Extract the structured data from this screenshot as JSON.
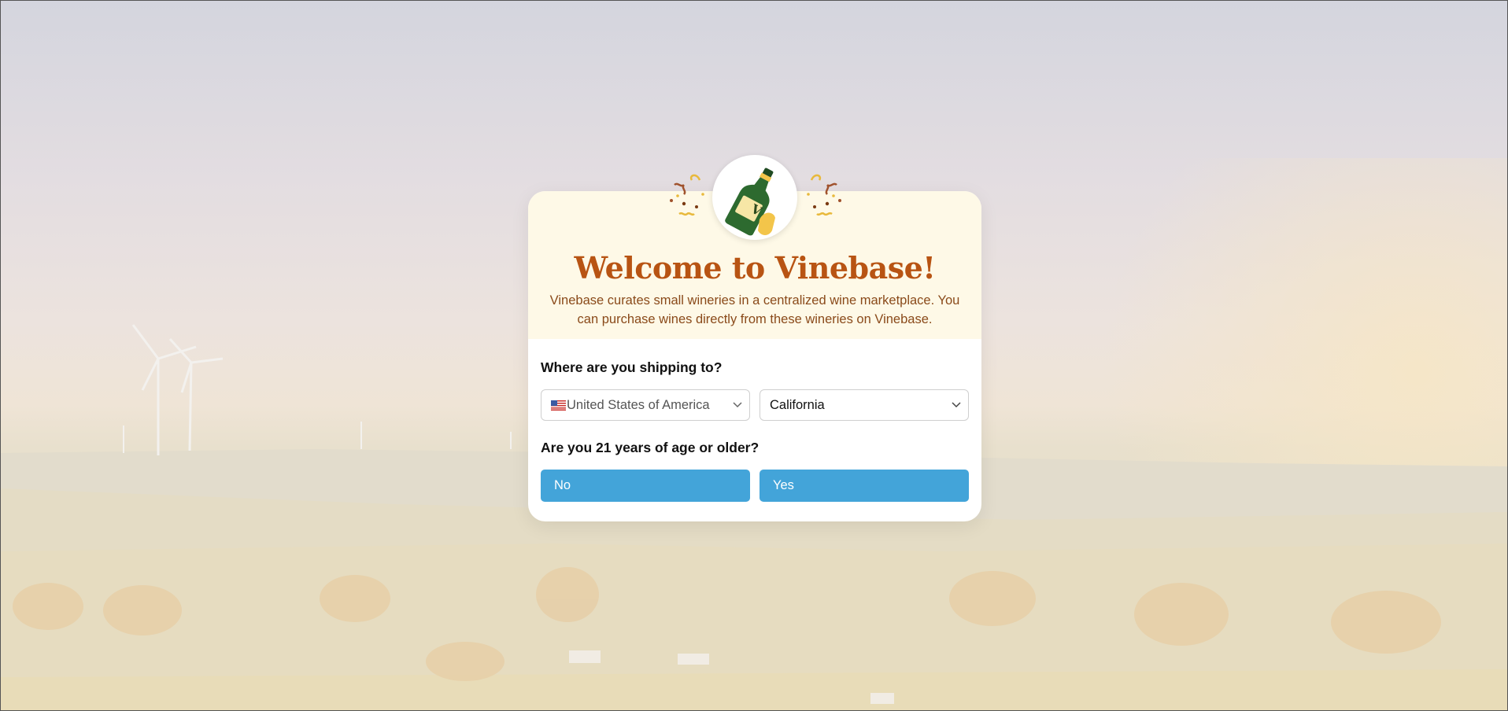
{
  "modal": {
    "title": "Welcome to Vinebase!",
    "description": "Vinebase curates small wineries in a centralized wine marketplace. You can purchase wines directly from these wineries on Vinebase.",
    "shipping_question": "Where are you shipping to?",
    "country_value": "United States of America",
    "state_value": "California",
    "age_question": "Are you 21 years of age or older?",
    "no_label": "No",
    "yes_label": "Yes",
    "emblem_letter": "V"
  },
  "colors": {
    "title": "#b85413",
    "description": "#8a4a1a",
    "button": "#43a4d9",
    "modal_top": "#fef9e7"
  },
  "icons": {
    "emblem": "wine-bottle-icon",
    "confetti": "confetti-icon",
    "flag": "us-flag-icon",
    "dropdown": "chevron-down-icon"
  }
}
